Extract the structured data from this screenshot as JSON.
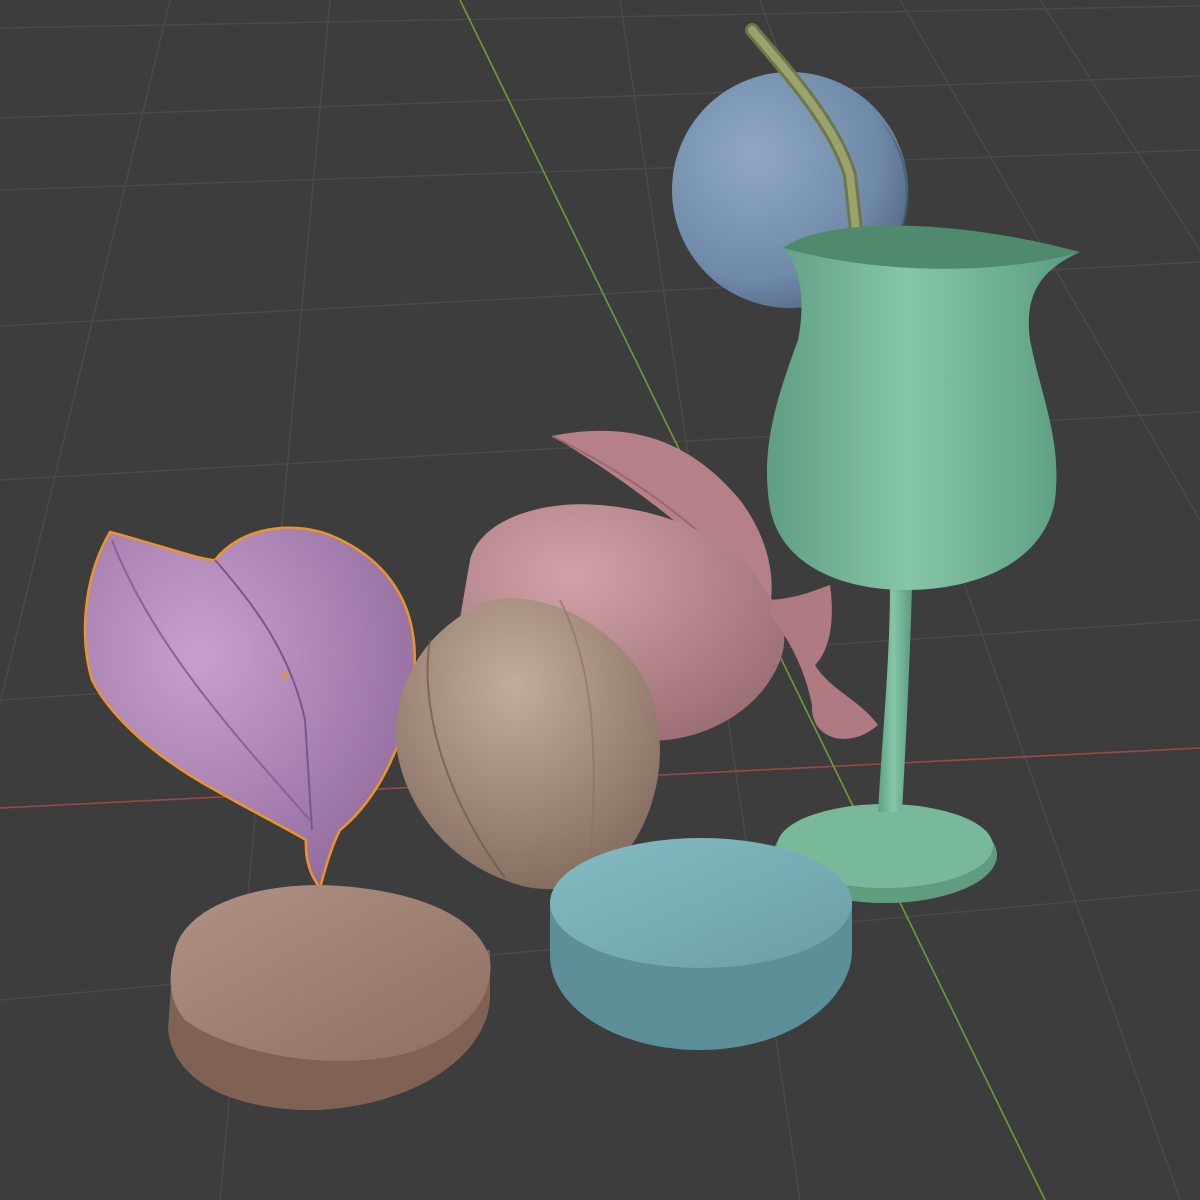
{
  "viewport": {
    "background": "#3d3d3d",
    "grid_color": "#4a4a4a",
    "x_axis_color": "#a0454c",
    "y_axis_color": "#6f9a3b"
  },
  "scene": {
    "selected_object": "leaf-fruit",
    "selection_outline_color": "#e8962a",
    "objects": [
      {
        "name": "blue-sphere",
        "color": "#6f8aa8"
      },
      {
        "name": "straw",
        "color": "#8f9964"
      },
      {
        "name": "green-glass",
        "color": "#6fb294"
      },
      {
        "name": "pink-fruit",
        "color": "#b98890"
      },
      {
        "name": "leaf-fruit",
        "color": "#ab81b4"
      },
      {
        "name": "brown-shell",
        "color": "#a08a7c"
      },
      {
        "name": "blue-disc",
        "color": "#6fa5ad"
      },
      {
        "name": "brown-disc",
        "color": "#9a7a6c"
      }
    ]
  }
}
